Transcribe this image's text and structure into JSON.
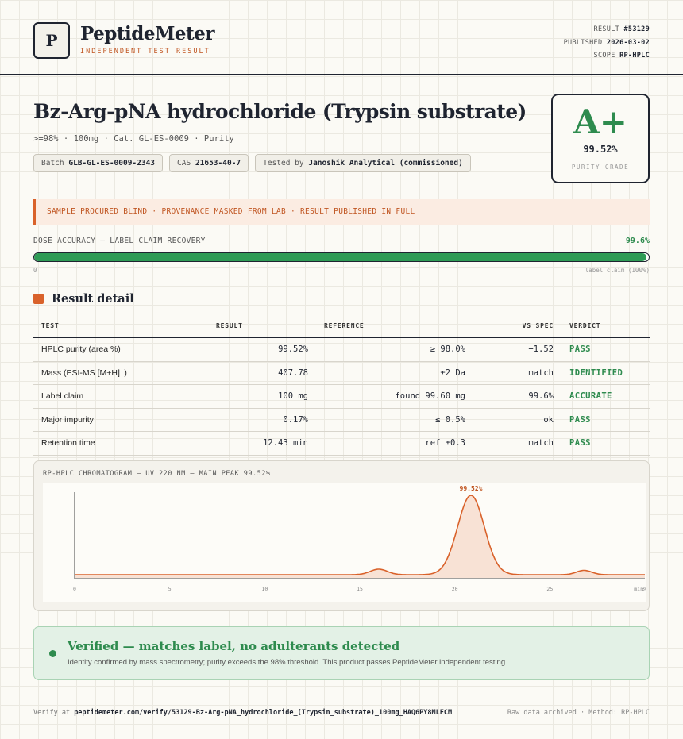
{
  "brand": {
    "logo_letter": "P",
    "name": "PeptideMeter",
    "tagline": "INDEPENDENT TEST RESULT"
  },
  "meta": {
    "result_label": "RESULT",
    "result_value": "#53129",
    "published_label": "PUBLISHED",
    "published_value": "2026-03-02",
    "scope_label": "SCOPE",
    "scope_value": "RP-HPLC"
  },
  "product": {
    "title": "Bz-Arg-pNA hydrochloride (Trypsin substrate)",
    "subtitle": ">=98% · 100mg · Cat. GL-ES-0009 · Purity",
    "batch_label": "Batch",
    "batch_value": "GLB-GL-ES-0009-2343",
    "cas_label": "CAS",
    "cas_value": "21653-40-7",
    "tested_label": "Tested by",
    "tested_value": "Janoshik Analytical (commissioned)"
  },
  "grade": {
    "letter": "A+",
    "value": "99.52%",
    "label": "PURITY GRADE"
  },
  "banner": "SAMPLE PROCURED BLIND · PROVENANCE MASKED FROM LAB · RESULT PUBLISHED IN FULL",
  "dose": {
    "label": "DOSE ACCURACY — LABEL CLAIM RECOVERY",
    "value": "99.6%",
    "fraction": 0.996,
    "min_label": "0",
    "max_label": "label claim (100%)"
  },
  "section_title": "Result detail",
  "table": {
    "headers": [
      "TEST",
      "RESULT",
      "REFERENCE",
      "VS SPEC",
      "VERDICT"
    ],
    "rows": [
      {
        "test": "HPLC purity (area %)",
        "result": "99.52%",
        "reference": "≥ 98.0%",
        "spec": "+1.52",
        "verdict": "PASS"
      },
      {
        "test": "Mass (ESI-MS [M+H]⁺)",
        "result": "407.78",
        "reference": "±2 Da",
        "spec": "match",
        "verdict": "IDENTIFIED"
      },
      {
        "test": "Label claim",
        "result": "100 mg",
        "reference": "found 99.60 mg",
        "spec": "99.6%",
        "verdict": "ACCURATE"
      },
      {
        "test": "Major impurity",
        "result": "0.17%",
        "reference": "≤ 0.5%",
        "spec": "ok",
        "verdict": "PASS"
      },
      {
        "test": "Retention time",
        "result": "12.43 min",
        "reference": "ref ±0.3",
        "spec": "match",
        "verdict": "PASS"
      }
    ]
  },
  "chart_data": {
    "type": "line",
    "title": "RP-HPLC CHROMATOGRAM — UV 220 NM — MAIN PEAK 99.52%",
    "xlim": [
      0,
      30
    ],
    "x_ticks": [
      "0",
      "5",
      "10",
      "15",
      "20",
      "25",
      "30"
    ],
    "x_unit": "min",
    "baseline": 0.04,
    "peaks": [
      {
        "center": 16.0,
        "height": 0.07,
        "width": 0.45
      },
      {
        "center": 20.85,
        "height": 1.0,
        "width": 0.7,
        "label": "99.52%"
      },
      {
        "center": 26.8,
        "height": 0.055,
        "width": 0.4
      }
    ],
    "line_color": "#d9622b",
    "fill_color": "#f8e2d5"
  },
  "verified": {
    "title": "Verified — matches label, no adulterants detected",
    "text": "Identity confirmed by mass spectrometry; purity exceeds the 98% threshold. This product passes PeptideMeter independent testing."
  },
  "footer": {
    "verify_label": "Verify at",
    "verify_url": "peptidemeter.com/verify/53129-Bz-Arg-pNA_hydrochloride_(Trypsin_substrate)_100mg_HAQ6PY8MLFCM",
    "right": "Raw data archived · Method: RP-HPLC"
  }
}
